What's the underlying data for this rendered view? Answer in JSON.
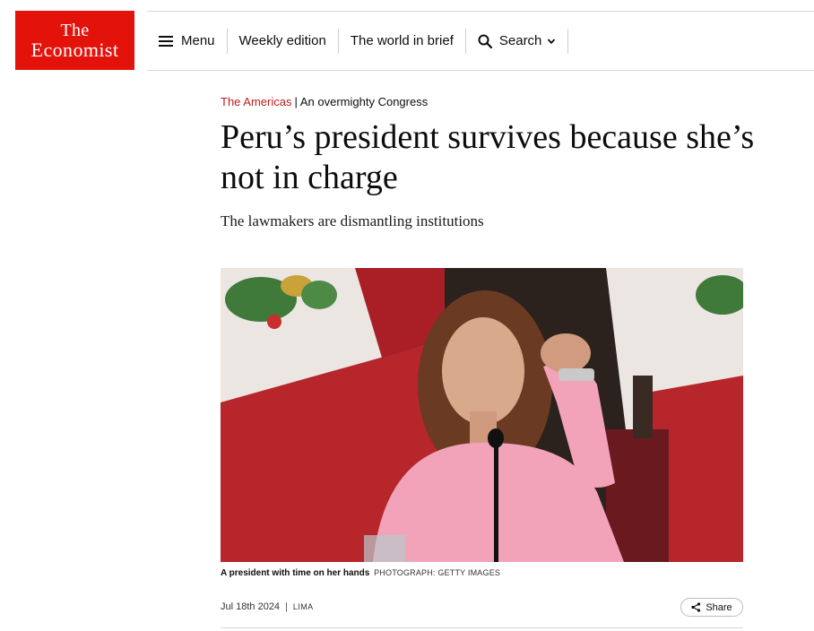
{
  "brand": {
    "logo_line1": "The",
    "logo_line2": "Economist",
    "color": "#e3120b"
  },
  "nav": {
    "menu_label": "Menu",
    "weekly_label": "Weekly edition",
    "world_label": "The world in brief",
    "search_label": "Search",
    "icons": [
      "menu-icon",
      "search-icon",
      "chevron-down-icon"
    ]
  },
  "article": {
    "section": "The Americas",
    "fly_title": "An overmighty Congress",
    "headline": "Peru’s president survives because she’s not in charge",
    "subheadline": "The lawmakers are dismantling institutions",
    "image": {
      "caption": "A president with time on her hands",
      "credit": "Photograph: Getty Images"
    },
    "date": "Jul 18th 2024",
    "location": "Lima",
    "share_label": "Share",
    "accent_color": "#c21c1c"
  }
}
